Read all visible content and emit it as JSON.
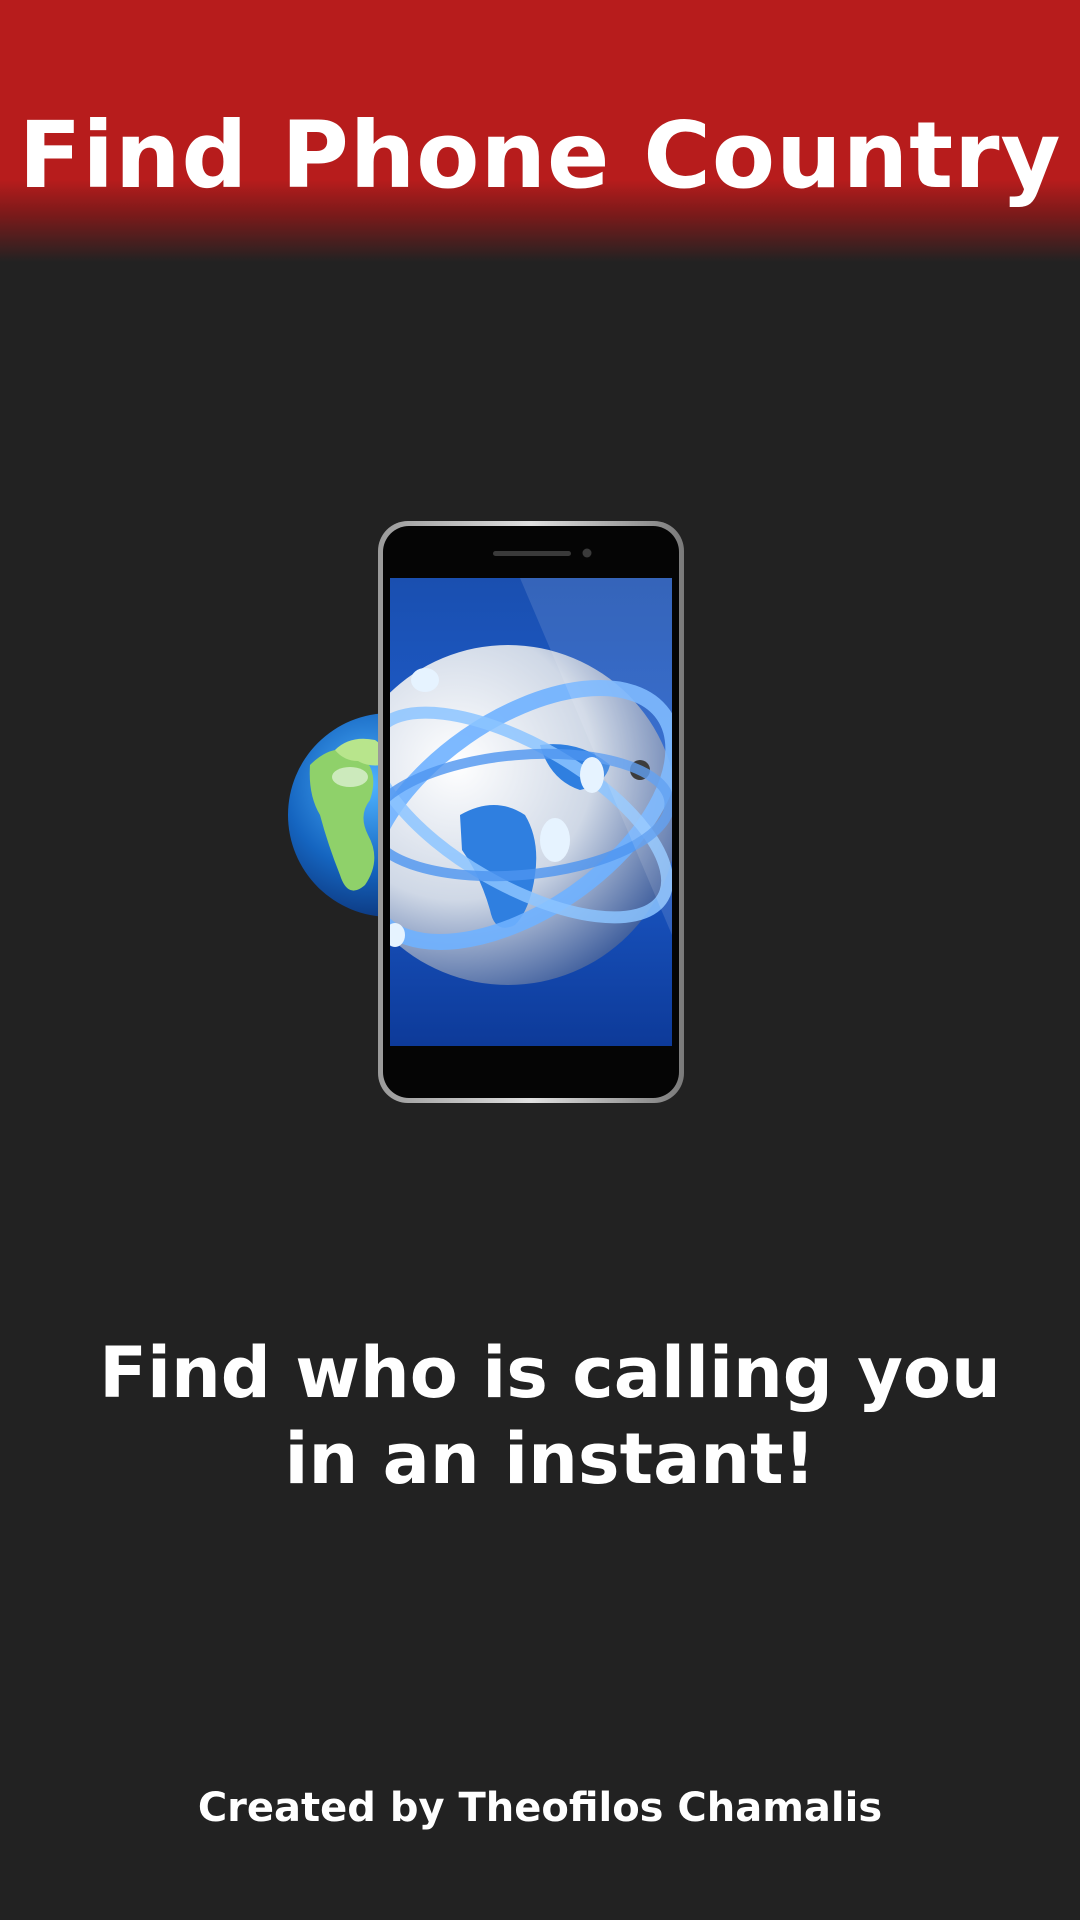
{
  "header": {
    "title": "Find Phone Country",
    "color": "#b71c1c"
  },
  "hero": {
    "icon": "phone-globe-icon"
  },
  "tagline": {
    "line1": "Find who is calling you",
    "line2": "in an instant!"
  },
  "footer": {
    "credit": "Created by Theofilos Chamalis"
  },
  "colors": {
    "background": "#222222",
    "text": "#ffffff"
  }
}
